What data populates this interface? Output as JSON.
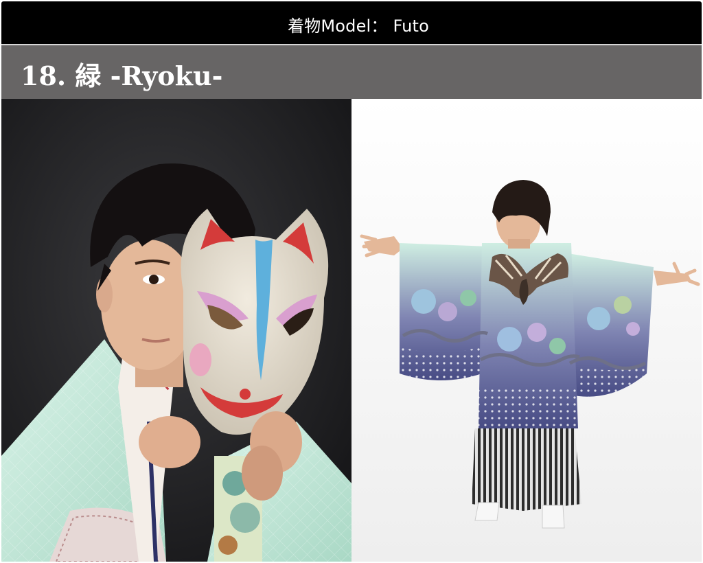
{
  "header": {
    "model_label": "着物Model： Futo"
  },
  "title": {
    "text": "18. 緑 -Ryoku-"
  },
  "photos": [
    {
      "name": "boy-with-fox-mask-photo"
    },
    {
      "name": "boy-back-view-kimono-photo"
    }
  ],
  "colors": {
    "top_bar": "#000000",
    "title_bar": "#676565",
    "kimono_mint": "#cfeee2",
    "hem_navy": "#4c4f86"
  }
}
